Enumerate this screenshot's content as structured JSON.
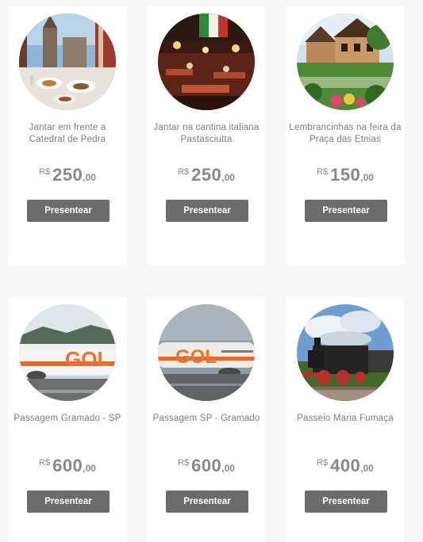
{
  "gifts": [
    {
      "title_line1": "Jantar em frente a",
      "title_line2": "Catedral de Pedra",
      "currency": "R$",
      "amount": "250",
      "cents": ",00",
      "button_label": "Presentear",
      "image_icon": "restaurant-cathedral-photo"
    },
    {
      "title_line1": "Jantar na cantina italiana",
      "title_line2": "Pastasciutta",
      "currency": "R$",
      "amount": "250",
      "cents": ",00",
      "button_label": "Presentear",
      "image_icon": "italian-cantina-photo"
    },
    {
      "title_line1": "Lembrancinhas na feira da",
      "title_line2": "Praça das Etnias",
      "currency": "R$",
      "amount": "150",
      "cents": ",00",
      "button_label": "Presentear",
      "image_icon": "fair-square-photo"
    },
    {
      "title_line1": "Passagem Gramado - SP",
      "title_line2": "",
      "currency": "R$",
      "amount": "600",
      "cents": ",00",
      "button_label": "Presentear",
      "image_icon": "gol-airplane-photo"
    },
    {
      "title_line1": "Passagem SP - Gramado",
      "title_line2": "",
      "currency": "R$",
      "amount": "600",
      "cents": ",00",
      "button_label": "Presentear",
      "image_icon": "gol-airplane-photo"
    },
    {
      "title_line1": "Passeio Maria Fumaça",
      "title_line2": "",
      "currency": "R$",
      "amount": "400",
      "cents": ",00",
      "button_label": "Presentear",
      "image_icon": "steam-train-photo"
    }
  ],
  "colors": {
    "background": "#f5f7f8",
    "card": "#ffffff",
    "text": "#7c7c7c",
    "price": "#888888",
    "button": "#6c6c6c",
    "button_text": "#ffffff"
  }
}
